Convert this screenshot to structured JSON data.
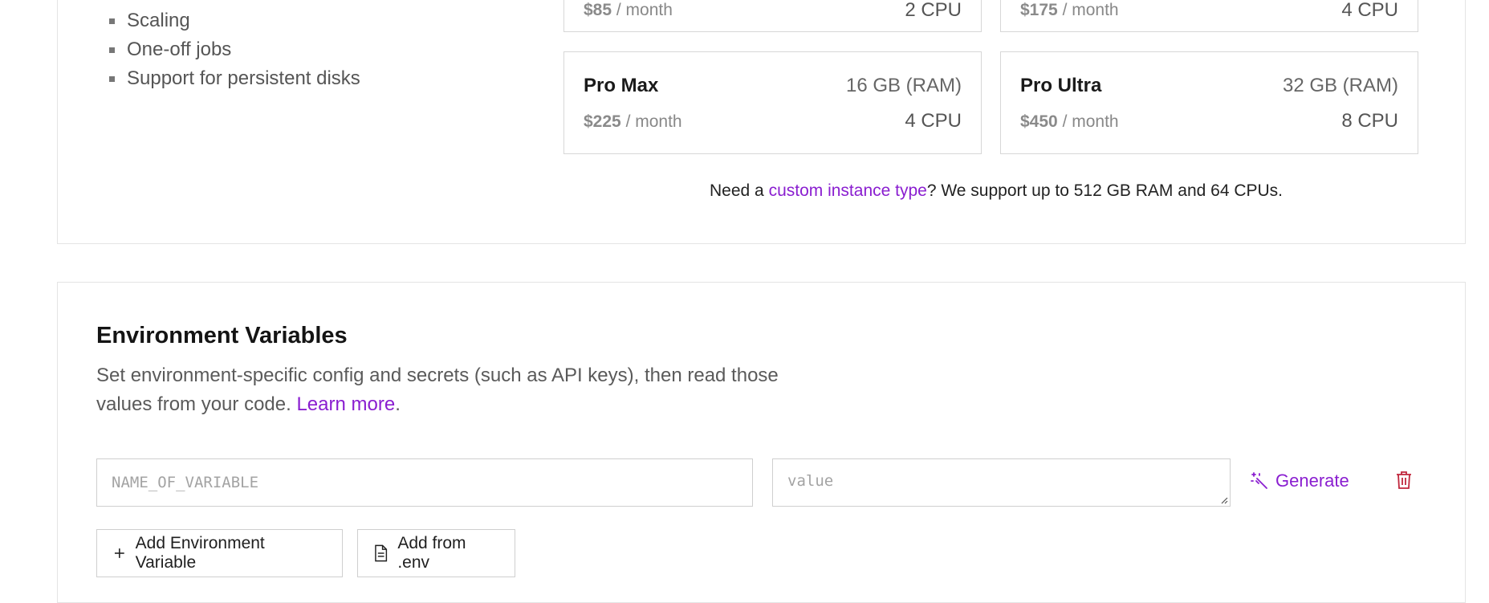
{
  "plans": {
    "features": [
      "Scaling",
      "One-off jobs",
      "Support for persistent disks"
    ],
    "partial_cards": [
      {
        "price": "$85",
        "period": "/ month",
        "cpu": "2 CPU"
      },
      {
        "price": "$175",
        "period": "/ month",
        "cpu": "4 CPU"
      }
    ],
    "cards": [
      {
        "name": "Pro Max",
        "ram": "16 GB (RAM)",
        "price": "$225",
        "period": "/ month",
        "cpu": "4 CPU"
      },
      {
        "name": "Pro Ultra",
        "ram": "32 GB (RAM)",
        "price": "$450",
        "period": "/ month",
        "cpu": "8 CPU"
      }
    ],
    "custom_note": {
      "prefix": "Need a ",
      "link": "custom instance type",
      "suffix": "? We support up to 512 GB RAM and 64 CPUs."
    }
  },
  "env": {
    "title": "Environment Variables",
    "description": "Set environment-specific config and secrets (such as API keys), then read those values from your code. ",
    "learn_more": "Learn more",
    "period": ".",
    "name_placeholder": "NAME_OF_VARIABLE",
    "value_placeholder": "value",
    "generate_label": "Generate",
    "add_variable_label": "Add Environment Variable",
    "add_from_env_label": "Add from .env"
  },
  "colors": {
    "accent": "#8a1ed0",
    "danger": "#c0263c",
    "border": "#d7d7d7"
  }
}
